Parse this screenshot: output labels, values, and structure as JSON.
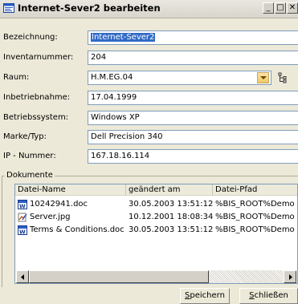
{
  "window": {
    "title": "Internet-Sever2 bearbeiten",
    "buttons": {
      "minimize": "_",
      "maximize": "□",
      "close": "✕"
    }
  },
  "form": {
    "fields": [
      {
        "label": "Bezeichnung:",
        "value": "Internet-Sever2",
        "selected": true
      },
      {
        "label": "Inventarnummer:",
        "value": "204"
      },
      {
        "label": "Raum:",
        "value": "H.M.EG.04"
      },
      {
        "label": "Inbetriebnahme:",
        "value": "17.04.1999"
      },
      {
        "label": "Betriebssystem:",
        "value": "Windows XP"
      },
      {
        "label": "Marke/Typ:",
        "value": "Dell Precision 340"
      },
      {
        "label": "IP - Nummer:",
        "value": "167.18.16.114"
      }
    ]
  },
  "documents": {
    "group_title": "Dokumente",
    "columns": [
      "Datei-Name",
      "geändert am",
      "Datei-Pfad"
    ],
    "rows": [
      {
        "icon": "word-doc-icon",
        "name": "10242941.doc",
        "modified": "30.05.2003 13:51:12",
        "path": "%BIS_ROOT%Demo"
      },
      {
        "icon": "image-file-icon",
        "name": "Server.jpg",
        "modified": "10.12.2001 18:08:34",
        "path": "%BIS_ROOT%Demo"
      },
      {
        "icon": "word-doc-icon",
        "name": "Terms & Conditions.doc",
        "modified": "30.05.2003 13:51:12",
        "path": "%BIS_ROOT%Demo"
      }
    ]
  },
  "footer": {
    "save_label": "Speichern",
    "save_mnemonic": "S",
    "close_label": "Schließen",
    "close_mnemonic": "S"
  }
}
